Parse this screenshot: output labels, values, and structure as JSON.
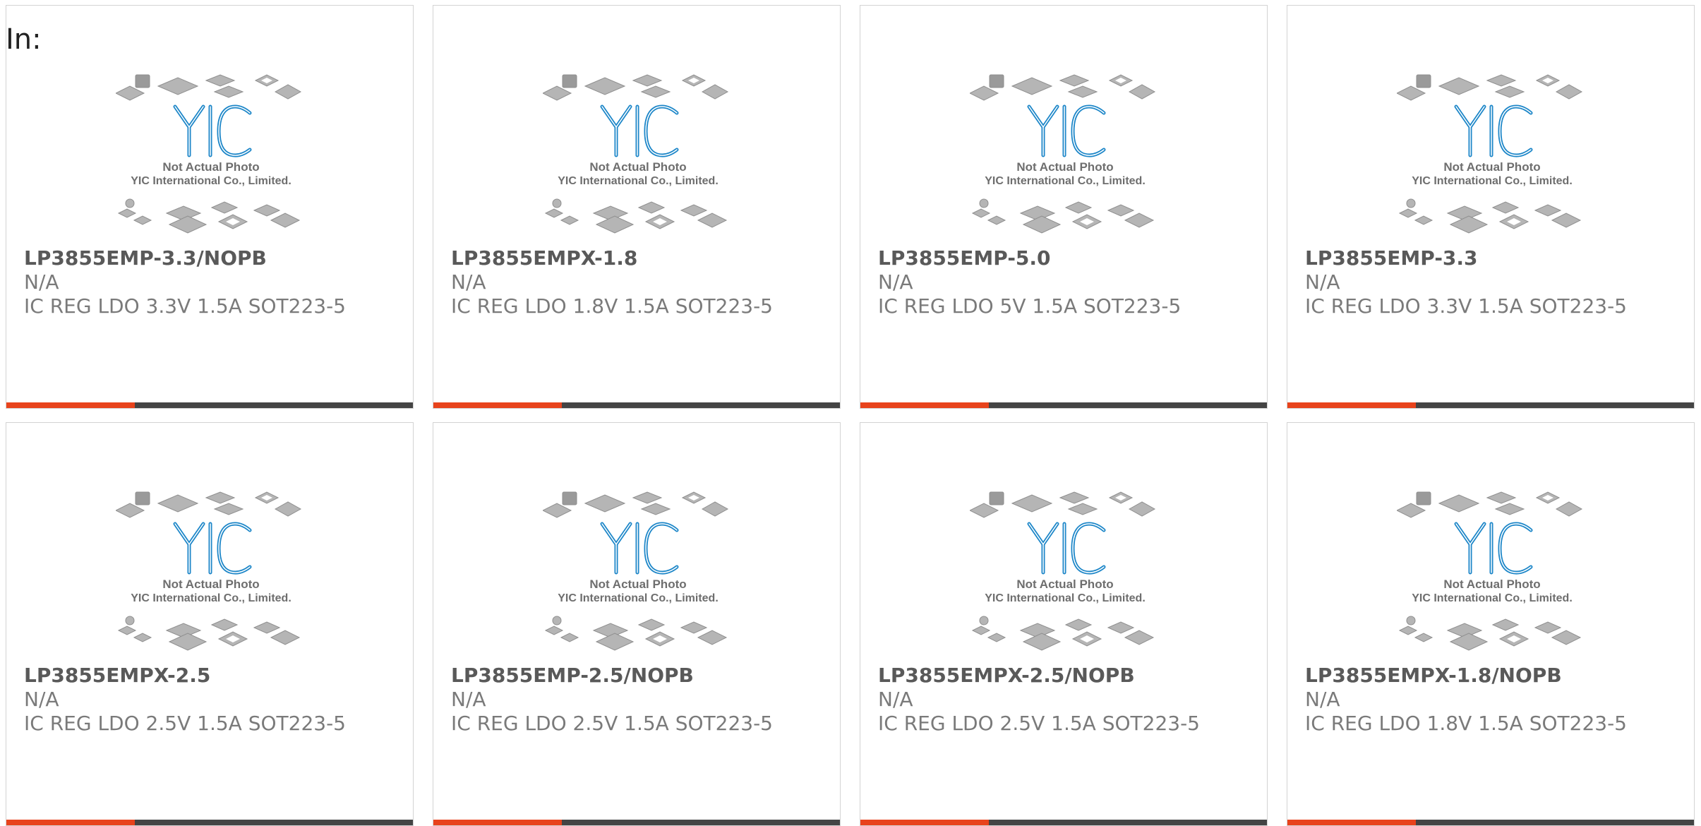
{
  "header": {
    "label": "In:"
  },
  "colors": {
    "accent": "#e8431c",
    "bar": "#444444",
    "logo": "#1c86c8"
  },
  "placeholder_image": {
    "logo_text": "YIC",
    "caption_line1": "Not Actual Photo",
    "caption_line2": "YIC International Co., Limited."
  },
  "products": [
    {
      "part_number": "LP3855EMP-3.3/NOPB",
      "manufacturer": "N/A",
      "description": "IC REG LDO 3.3V 1.5A SOT223-5"
    },
    {
      "part_number": "LP3855EMPX-1.8",
      "manufacturer": "N/A",
      "description": "IC REG LDO 1.8V 1.5A SOT223-5"
    },
    {
      "part_number": "LP3855EMP-5.0",
      "manufacturer": "N/A",
      "description": "IC REG LDO 5V 1.5A SOT223-5"
    },
    {
      "part_number": "LP3855EMP-3.3",
      "manufacturer": "N/A",
      "description": "IC REG LDO 3.3V 1.5A SOT223-5"
    },
    {
      "part_number": "LP3855EMPX-2.5",
      "manufacturer": "N/A",
      "description": "IC REG LDO 2.5V 1.5A SOT223-5"
    },
    {
      "part_number": "LP3855EMP-2.5/NOPB",
      "manufacturer": "N/A",
      "description": "IC REG LDO 2.5V 1.5A SOT223-5"
    },
    {
      "part_number": "LP3855EMPX-2.5/NOPB",
      "manufacturer": "N/A",
      "description": "IC REG LDO 2.5V 1.5A SOT223-5"
    },
    {
      "part_number": "LP3855EMPX-1.8/NOPB",
      "manufacturer": "N/A",
      "description": "IC REG LDO 1.8V 1.5A SOT223-5"
    }
  ]
}
